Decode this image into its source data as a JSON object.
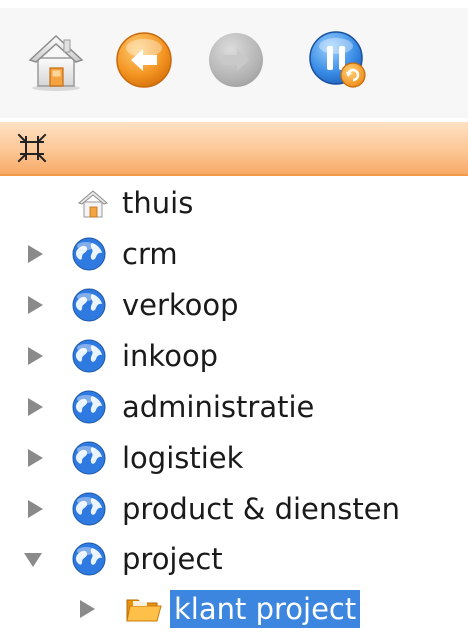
{
  "toolbar": {
    "home_icon": "home-icon",
    "back_icon": "back-arrow-icon",
    "forward_icon": "forward-arrow-icon",
    "refresh_icon": "refresh-icon"
  },
  "panel": {
    "collapse_icon": "collapse-all-icon",
    "accent_color": "#f8aa66"
  },
  "tree": {
    "items": [
      {
        "label": "thuis",
        "icon": "home-icon",
        "expander": "none"
      },
      {
        "label": "crm",
        "icon": "globe-icon",
        "expander": "collapsed"
      },
      {
        "label": "verkoop",
        "icon": "globe-icon",
        "expander": "collapsed"
      },
      {
        "label": "inkoop",
        "icon": "globe-icon",
        "expander": "collapsed"
      },
      {
        "label": "administratie",
        "icon": "globe-icon",
        "expander": "collapsed"
      },
      {
        "label": "logistiek",
        "icon": "globe-icon",
        "expander": "collapsed"
      },
      {
        "label": "product & diensten",
        "icon": "globe-icon",
        "expander": "collapsed"
      },
      {
        "label": "project",
        "icon": "globe-icon",
        "expander": "expanded"
      },
      {
        "label": "klant project",
        "icon": "folder-icon",
        "expander": "collapsed",
        "selected": true
      }
    ],
    "selection_color": "#3d86e0"
  }
}
